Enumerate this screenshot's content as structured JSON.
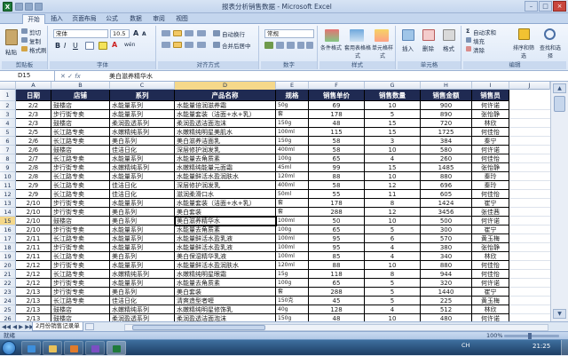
{
  "window": {
    "title": "报表分析销售数据 - Microsoft Excel",
    "app_icon": "X"
  },
  "ribbon_tabs": [
    "开始",
    "插入",
    "页面布局",
    "公式",
    "数据",
    "审阅",
    "视图"
  ],
  "ribbon": {
    "clipboard": {
      "paste": "粘贴",
      "cut": "剪切",
      "copy": "复制",
      "format_painter": "格式刷",
      "label": "剪贴板"
    },
    "font": {
      "name": "宋体",
      "size": "10.5",
      "label": "字体",
      "grow": "A",
      "shrink": "A",
      "bold": "B",
      "italic": "I",
      "underline": "U",
      "font_color": "A",
      "phonetic": "wén"
    },
    "alignment": {
      "wrap": "自动换行",
      "merge": "合并后居中",
      "label": "对齐方式"
    },
    "number": {
      "format": "常规",
      "label": "数字"
    },
    "styles": {
      "cond": "条件格式",
      "table": "套用表格格式",
      "cell": "单元格样式",
      "label": "样式"
    },
    "cells": {
      "insert": "插入",
      "delete": "删除",
      "format": "格式",
      "label": "单元格"
    },
    "editing": {
      "autosum": "自动求和",
      "fill": "填充",
      "clear": "清除",
      "sort": "排序和筛选",
      "find": "查找和选择",
      "label": "编辑"
    }
  },
  "formula_bar": {
    "name_box": "D15",
    "fx": "fx",
    "content": "美白滋养精华水"
  },
  "columns": [
    "A",
    "B",
    "C",
    "D",
    "E",
    "F",
    "G",
    "H",
    "I",
    "J"
  ],
  "headers": [
    "日期",
    "店铺",
    "系列",
    "产品名称",
    "规格",
    "销售单价",
    "销售数量",
    "销售金额",
    "销售员"
  ],
  "rows": [
    [
      "2/2",
      "鼓楼店",
      "水能量系列",
      "水能量倍润滋养霜",
      "50g",
      "69",
      "10",
      "900",
      "何许诺"
    ],
    [
      "2/3",
      "步行街专卖",
      "水能量系列",
      "水能量套装（洁面+水+乳）",
      "套",
      "178",
      "5",
      "890",
      "张怡静"
    ],
    [
      "2/3",
      "鼓楼店",
      "柔润盈透系列",
      "柔润盈透洁面泡沫",
      "150g",
      "48",
      "15",
      "720",
      "林欣"
    ],
    [
      "2/5",
      "长江路专卖",
      "水嫩精纯系列",
      "水嫩精纯明星美肌水",
      "100ml",
      "115",
      "15",
      "1725",
      "何佳怡"
    ],
    [
      "2/6",
      "长江路专卖",
      "美白系列",
      "美白滋养洁面乳",
      "150g",
      "58",
      "3",
      "384",
      "秦宁"
    ],
    [
      "2/6",
      "鼓楼店",
      "佳洁日化",
      "深层修护润发乳",
      "400ml",
      "58",
      "10",
      "580",
      "何许诺"
    ],
    [
      "2/7",
      "长江路专卖",
      "水能量系列",
      "水能量去角质素",
      "100g",
      "65",
      "4",
      "260",
      "何佳怡"
    ],
    [
      "2/8",
      "步行街专卖",
      "水嫩精纯系列",
      "水嫩精纯能量元面霜",
      "45ml",
      "99",
      "15",
      "1485",
      "张怡静"
    ],
    [
      "2/8",
      "长江路专卖",
      "水能量系列",
      "水能量鲜活水盈润肤水",
      "120ml",
      "88",
      "10",
      "880",
      "秦玲"
    ],
    [
      "2/9",
      "长江路专卖",
      "佳洁日化",
      "深层修护润发乳",
      "400ml",
      "58",
      "12",
      "696",
      "秦玲"
    ],
    [
      "2/9",
      "长江路专卖",
      "佳洁日化",
      "滋润柔滑口水",
      "50ml",
      "55",
      "11",
      "605",
      "何佳怡"
    ],
    [
      "2/10",
      "步行街专卖",
      "水能量系列",
      "水能量套装（洁面+水+乳）",
      "套",
      "178",
      "8",
      "1424",
      "崔宁"
    ],
    [
      "2/10",
      "步行街专卖",
      "美白系列",
      "美白套装",
      "套",
      "288",
      "12",
      "3456",
      "张佳茜"
    ],
    [
      "2/10",
      "鼓楼店",
      "美白系列",
      "美白滋养精华水",
      "100ml",
      "50",
      "10",
      "500",
      "何许诺"
    ],
    [
      "2/10",
      "步行街专卖",
      "水能量系列",
      "水能量去角质素",
      "100g",
      "65",
      "5",
      "300",
      "崔宁"
    ],
    [
      "2/11",
      "长江路专卖",
      "水能量系列",
      "水能量鲜活水盈乳液",
      "100ml",
      "95",
      "6",
      "570",
      "黄玉梅"
    ],
    [
      "2/11",
      "步行街专卖",
      "水能量系列",
      "水能量鲜活水盈乳液",
      "100ml",
      "95",
      "4",
      "380",
      "张怡静"
    ],
    [
      "2/11",
      "长江路专卖",
      "美白系列",
      "美白保湿精华乳液",
      "100ml",
      "85",
      "4",
      "340",
      "林欣"
    ],
    [
      "2/12",
      "步行街专卖",
      "水能量系列",
      "水能量鲜活水盈润肤水",
      "120ml",
      "88",
      "10",
      "880",
      "何佳怡"
    ],
    [
      "2/12",
      "长江路专卖",
      "水嫩精纯系列",
      "水嫩精纯明星眼霜",
      "15g",
      "118",
      "8",
      "944",
      "何佳怡"
    ],
    [
      "2/12",
      "步行街专卖",
      "水能量系列",
      "水能量去角质素",
      "100g",
      "65",
      "5",
      "320",
      "何许诺"
    ],
    [
      "2/13",
      "步行街专卖",
      "美白系列",
      "美白套装",
      "套",
      "288",
      "5",
      "1440",
      "崔宁"
    ],
    [
      "2/13",
      "长江路专卖",
      "佳洁日化",
      "清爽造型者喱",
      "150克",
      "45",
      "5",
      "225",
      "黄玉梅"
    ],
    [
      "2/13",
      "鼓楼店",
      "水嫩精纯系列",
      "水嫩精纯明星修饰乳",
      "40g",
      "128",
      "4",
      "512",
      "林欣"
    ],
    [
      "2/13",
      "鼓楼店",
      "柔润盈透系列",
      "柔润盈透洁面泡沫",
      "150g",
      "48",
      "10",
      "480",
      "何许诺"
    ]
  ],
  "sheet_tab": "2月份销售记录单",
  "status": {
    "mode": "就绪",
    "zoom": "100%"
  },
  "taskbar": {
    "time": "21:25",
    "tray": "CH"
  },
  "colors": {
    "header_fill": "#1f2a52",
    "header_text": "#ffffff",
    "select": "#f5d88a"
  }
}
